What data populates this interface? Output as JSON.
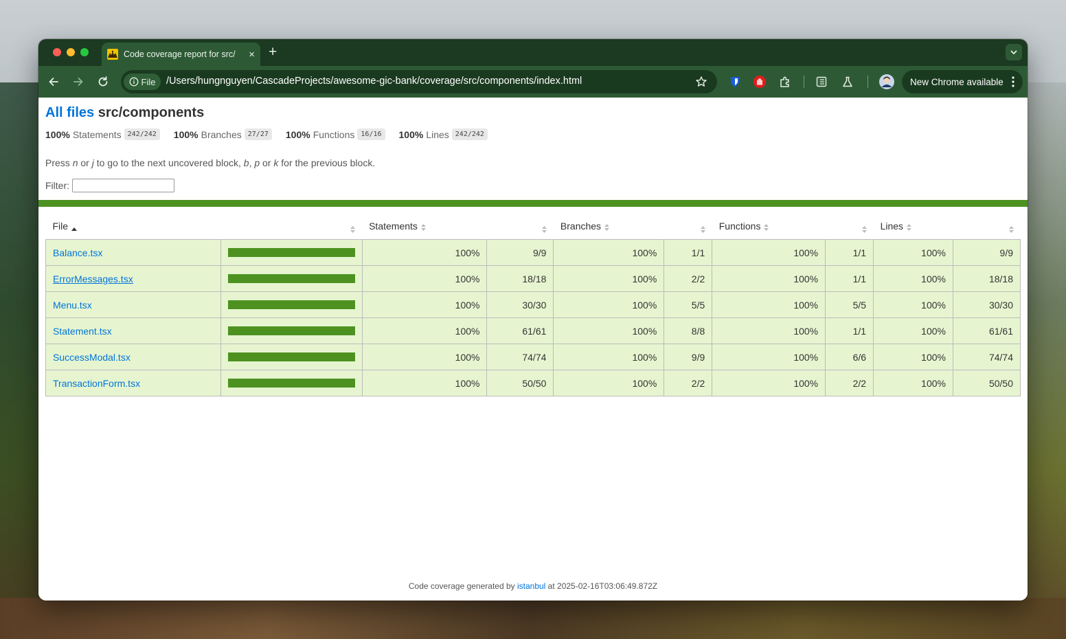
{
  "browser": {
    "tab_title": "Code coverage report for src/",
    "tab_close": "×",
    "new_tab": "+",
    "file_chip": "File",
    "url": "/Users/hungnguyen/CascadeProjects/awesome-gic-bank/coverage/src/components/index.html",
    "update_button": "New Chrome available",
    "icons": [
      "back-icon",
      "forward-icon",
      "reload-icon",
      "info-icon",
      "bookmark-star-icon",
      "bitwarden-icon",
      "adblock-icon",
      "extensions-icon",
      "reading-list-icon",
      "labs-icon",
      "profile-avatar",
      "menu-icon"
    ],
    "frame_color": "#1b3a21",
    "toolbar_color": "#2d5a35"
  },
  "report": {
    "breadcrumb_all": "All files",
    "title": "src/components",
    "summary": [
      {
        "pct": "100%",
        "label": "Statements",
        "frac": "242/242"
      },
      {
        "pct": "100%",
        "label": "Branches",
        "frac": "27/27"
      },
      {
        "pct": "100%",
        "label": "Functions",
        "frac": "16/16"
      },
      {
        "pct": "100%",
        "label": "Lines",
        "frac": "242/242"
      }
    ],
    "hint_parts": [
      "Press ",
      "n",
      " or ",
      "j",
      " to go to the next uncovered block, ",
      "b",
      ", ",
      "p",
      " or ",
      "k",
      " for the previous block."
    ],
    "filter_label": "Filter:",
    "filter_value": "",
    "accent": "#4d9221",
    "headers": [
      "File",
      "Statements",
      "Branches",
      "Functions",
      "Lines"
    ],
    "rows": [
      {
        "file": "Balance.tsx",
        "coverage": 1.0,
        "stmt_pct": "100%",
        "stmt": "9/9",
        "br_pct": "100%",
        "br": "1/1",
        "fn_pct": "100%",
        "fn": "1/1",
        "ln_pct": "100%",
        "ln": "9/9"
      },
      {
        "file": "ErrorMessages.tsx",
        "coverage": 1.0,
        "stmt_pct": "100%",
        "stmt": "18/18",
        "br_pct": "100%",
        "br": "2/2",
        "fn_pct": "100%",
        "fn": "1/1",
        "ln_pct": "100%",
        "ln": "18/18"
      },
      {
        "file": "Menu.tsx",
        "coverage": 1.0,
        "stmt_pct": "100%",
        "stmt": "30/30",
        "br_pct": "100%",
        "br": "5/5",
        "fn_pct": "100%",
        "fn": "5/5",
        "ln_pct": "100%",
        "ln": "30/30"
      },
      {
        "file": "Statement.tsx",
        "coverage": 1.0,
        "stmt_pct": "100%",
        "stmt": "61/61",
        "br_pct": "100%",
        "br": "8/8",
        "fn_pct": "100%",
        "fn": "1/1",
        "ln_pct": "100%",
        "ln": "61/61"
      },
      {
        "file": "SuccessModal.tsx",
        "coverage": 1.0,
        "stmt_pct": "100%",
        "stmt": "74/74",
        "br_pct": "100%",
        "br": "9/9",
        "fn_pct": "100%",
        "fn": "6/6",
        "ln_pct": "100%",
        "ln": "74/74"
      },
      {
        "file": "TransactionForm.tsx",
        "coverage": 1.0,
        "stmt_pct": "100%",
        "stmt": "50/50",
        "br_pct": "100%",
        "br": "2/2",
        "fn_pct": "100%",
        "fn": "2/2",
        "ln_pct": "100%",
        "ln": "50/50"
      }
    ],
    "footer_prefix": "Code coverage generated by ",
    "footer_link": "istanbul",
    "footer_suffix": " at 2025-02-16T03:06:49.872Z"
  }
}
